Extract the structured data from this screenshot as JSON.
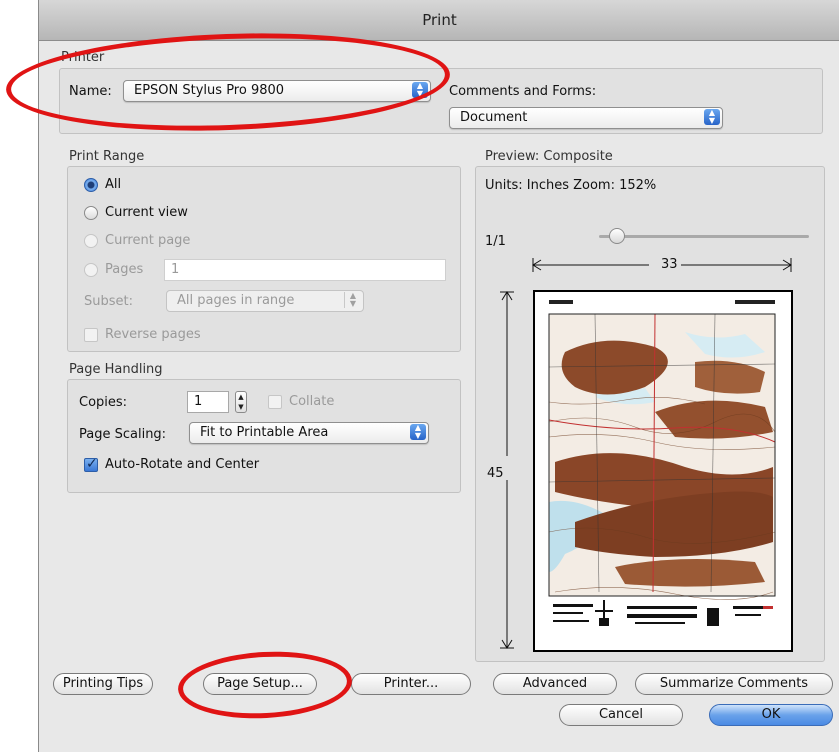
{
  "window": {
    "title": "Print"
  },
  "printer": {
    "section_label": "Printer",
    "name_label": "Name:",
    "name_value": "EPSON Stylus Pro 9800",
    "comments_label": "Comments and Forms:",
    "comments_value": "Document"
  },
  "print_range": {
    "section_label": "Print Range",
    "options": [
      {
        "label": "All",
        "selected": true,
        "enabled": true
      },
      {
        "label": "Current view",
        "selected": false,
        "enabled": true
      },
      {
        "label": "Current page",
        "selected": false,
        "enabled": false
      },
      {
        "label": "Pages",
        "selected": false,
        "enabled": false
      }
    ],
    "pages_value": "1",
    "subset_label": "Subset:",
    "subset_value": "All pages in range",
    "reverse_label": "Reverse pages"
  },
  "page_handling": {
    "section_label": "Page Handling",
    "copies_label": "Copies:",
    "copies_value": "1",
    "collate_label": "Collate",
    "scaling_label": "Page Scaling:",
    "scaling_value": "Fit to Printable Area",
    "autorotate_label": "Auto-Rotate and Center",
    "autorotate_checked": true
  },
  "preview": {
    "section_label": "Preview: Composite",
    "units_zoom": "Units: Inches Zoom: 152%",
    "page_count": "1/1",
    "width": "33",
    "height": "45",
    "zoom_slider_fraction": 0.05
  },
  "buttons": {
    "printing_tips": "Printing Tips",
    "page_setup": "Page Setup...",
    "printer": "Printer...",
    "advanced": "Advanced",
    "summarize": "Summarize Comments",
    "cancel": "Cancel",
    "ok": "OK"
  },
  "colors": {
    "highlight_circle": "#e01414",
    "default_button": "#4a8ae4"
  }
}
